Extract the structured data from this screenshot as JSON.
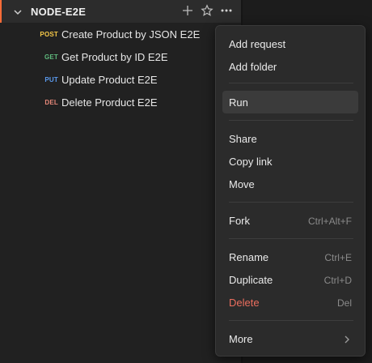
{
  "collection": {
    "name": "NODE-E2E",
    "accent_color": "#ff6c37"
  },
  "requests": [
    {
      "method": "POST",
      "method_color": "#f7c948",
      "name": "Create Product by JSON E2E"
    },
    {
      "method": "GET",
      "method_color": "#5fba7d",
      "name": "Get Product by ID E2E"
    },
    {
      "method": "PUT",
      "method_color": "#5b9bf0",
      "name": "Update Product E2E"
    },
    {
      "method": "DEL",
      "method_color": "#e8897a",
      "name": "Delete Prorduct E2E"
    }
  ],
  "menu": {
    "add_request": "Add request",
    "add_folder": "Add folder",
    "run": "Run",
    "share": "Share",
    "copy_link": "Copy link",
    "move": "Move",
    "fork": "Fork",
    "fork_shortcut": "Ctrl+Alt+F",
    "rename": "Rename",
    "rename_shortcut": "Ctrl+E",
    "duplicate": "Duplicate",
    "duplicate_shortcut": "Ctrl+D",
    "delete": "Delete",
    "delete_shortcut": "Del",
    "more": "More"
  }
}
